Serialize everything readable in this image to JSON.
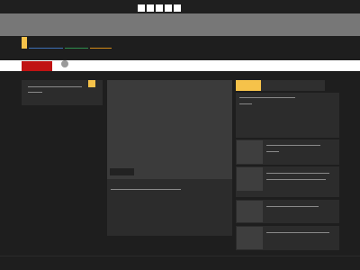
{
  "colors": {
    "background": "#1e1e1e",
    "banner": "#777777",
    "accent_yellow": "#f6c24a",
    "accent_red": "#c01313",
    "panel": "#2c2c2c"
  },
  "icons": {
    "top_squares": [
      "square-icon",
      "square-icon",
      "square-icon",
      "square-icon",
      "square-icon"
    ],
    "nav_accent": "nav-accent-marker",
    "strip_circle": "circle-icon"
  },
  "nav": {
    "links": [
      {
        "name": "nav-link-blue",
        "color": "#3d6fb6"
      },
      {
        "name": "nav-link-green",
        "color": "#2f8f4e"
      },
      {
        "name": "nav-link-orange",
        "color": "#d38a17"
      }
    ]
  }
}
